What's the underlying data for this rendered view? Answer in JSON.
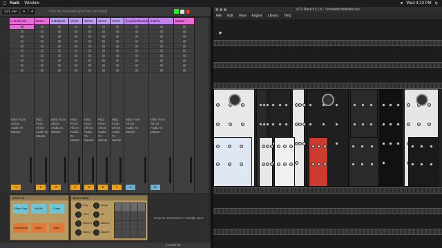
{
  "menubar": {
    "app_name": "Rack",
    "items": [
      "Window"
    ],
    "clock": "Wed 4:23 PM"
  },
  "ableton": {
    "tempo": "121.00",
    "signature": "4 / 4",
    "hint": "Intro the next take  [Intro the next take]",
    "track_headers": [
      "1 Gonk Kit",
      "Drum",
      "3 Mellyme",
      "VCV1",
      "VCV2",
      "VCV3",
      "VCV4",
      "8 Hybrid Reverb",
      "9 Echo",
      "Master"
    ],
    "track_colors": [
      "#e66bd6",
      "#e66bd6",
      "#b89ce8",
      "#b89ce8",
      "#b89ce8",
      "#b89ce8",
      "#b89ce8",
      "#c083ec",
      "#c083ec",
      "#e66bd6"
    ],
    "routing_labels": [
      "MIDI From",
      "All Ins",
      "Audio To",
      "Master"
    ],
    "track_numbers": [
      "1",
      "2",
      "3",
      "4",
      "5",
      "6",
      "7",
      "A",
      "B",
      ""
    ],
    "device_a": {
      "title": "Gonk Kit",
      "pads": [
        "Filter Freq",
        "Mid/Hi",
        "Trans",
        "Resonance",
        "Reso",
        "Bass"
      ]
    },
    "device_b": {
      "title": "Drum Rack",
      "macros": [
        "Freq",
        "Decay",
        "Trans",
        "Vel",
        "Macro 5",
        "Macro 6",
        "Macro 7",
        "Macro 8"
      ]
    },
    "device_c_text": "Drop an Instrument or Sample Here",
    "status_right": "1-Gonk Kit"
  },
  "vcv": {
    "window_title": "VCV Rack v1.1.6 - *unsaved modules.vcv",
    "menu": [
      "File",
      "Edit",
      "View",
      "Engine",
      "Library",
      "Help"
    ]
  }
}
